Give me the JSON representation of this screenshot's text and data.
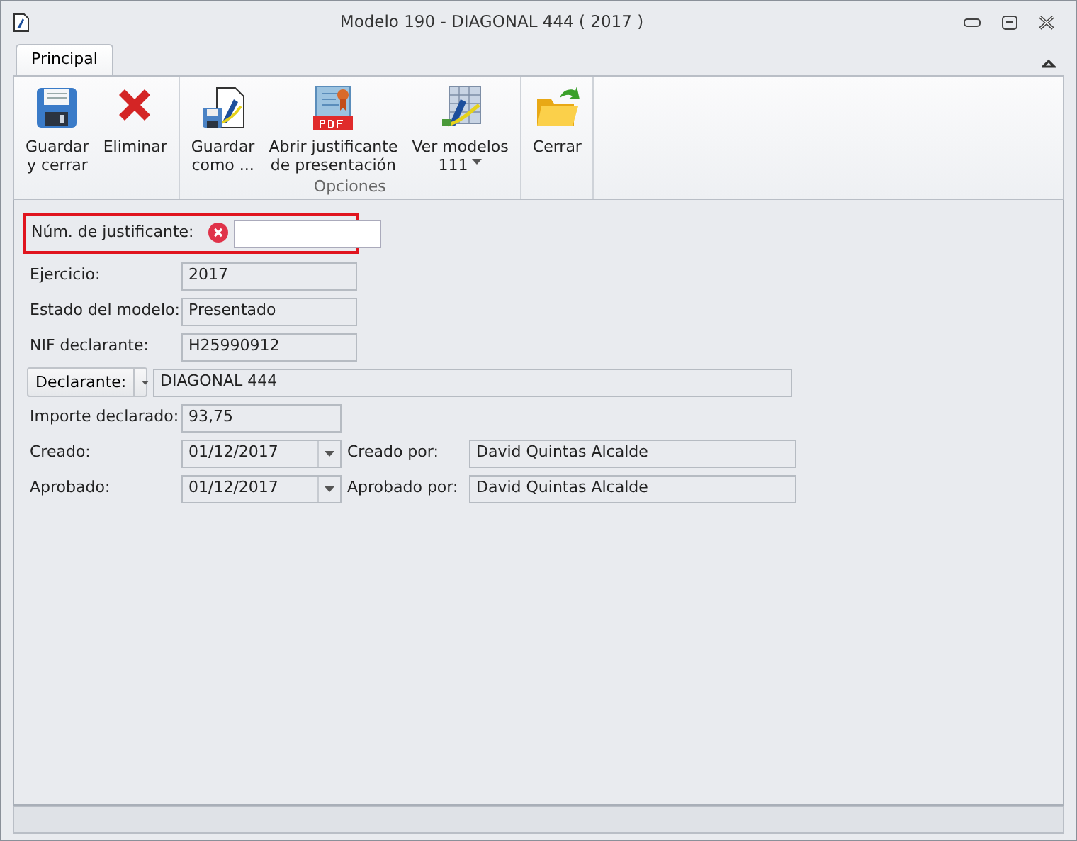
{
  "window": {
    "title": "Modelo 190 - DIAGONAL 444 ( 2017 )"
  },
  "tabs": [
    {
      "label": "Principal",
      "selected": true
    }
  ],
  "ribbon": {
    "groups": [
      {
        "buttons": [
          {
            "kind": "save",
            "label": "Guardar\ny cerrar"
          },
          {
            "kind": "delete",
            "label": "Eliminar"
          }
        ]
      },
      {
        "label": "Opciones",
        "buttons": [
          {
            "kind": "save-as",
            "label": "Guardar\ncomo ..."
          },
          {
            "kind": "pdf",
            "label": "Abrir justificante\nde presentación"
          },
          {
            "kind": "models",
            "label": "Ver modelos\n111",
            "dropdown": true
          }
        ]
      },
      {
        "buttons": [
          {
            "kind": "close",
            "label": "Cerrar"
          }
        ]
      }
    ]
  },
  "form": [
    {
      "kind": "error",
      "label": "Núm. de justificante:"
    },
    {
      "kind": "text",
      "label": "Ejercicio:",
      "value": "2017"
    },
    {
      "kind": "text",
      "label": "Estado del modelo:",
      "value": "Presentado"
    },
    {
      "kind": "text",
      "label": "NIF declarante:",
      "value": "H25990912"
    },
    {
      "kind": "combo",
      "label": "Declarante:",
      "value": "DIAGONAL 444"
    },
    {
      "kind": "amount",
      "label": "Importe declarado:",
      "value": "93,75"
    },
    {
      "kind": "date",
      "label": "Creado:",
      "value": "01/12/2017",
      "by_label": "Creado por:",
      "by_value": "David Quintas Alcalde"
    },
    {
      "kind": "date",
      "label": "Aprobado:",
      "value": "01/12/2017",
      "by_label": "Aprobado por:",
      "by_value": "David Quintas Alcalde"
    }
  ]
}
